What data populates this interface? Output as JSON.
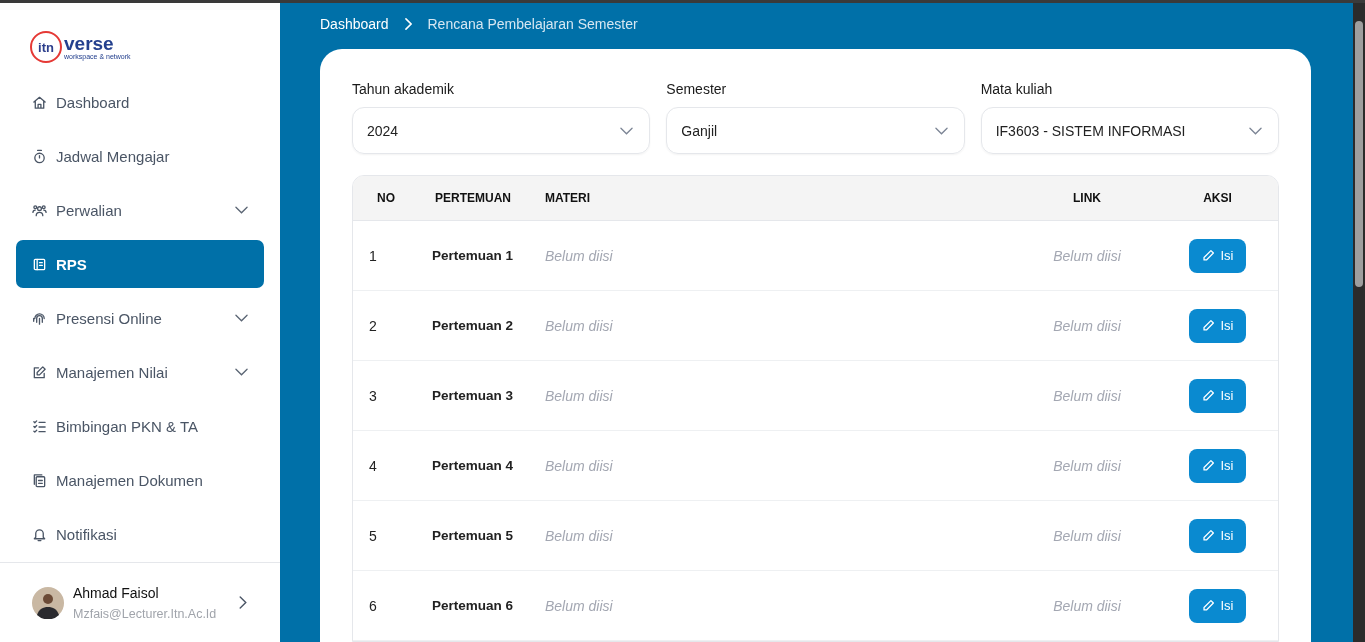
{
  "logo": {
    "mark": "itn",
    "word": "verse",
    "tagline": "workspace & network"
  },
  "sidebar": {
    "items": [
      {
        "label": "Dashboard",
        "selected": false,
        "expandable": false
      },
      {
        "label": "Jadwal Mengajar",
        "selected": false,
        "expandable": false
      },
      {
        "label": "Perwalian",
        "selected": false,
        "expandable": true
      },
      {
        "label": "RPS",
        "selected": true,
        "expandable": false
      },
      {
        "label": "Presensi Online",
        "selected": false,
        "expandable": true
      },
      {
        "label": "Manajemen Nilai",
        "selected": false,
        "expandable": true
      },
      {
        "label": "Bimbingan PKN & TA",
        "selected": false,
        "expandable": false
      },
      {
        "label": "Manajemen Dokumen",
        "selected": false,
        "expandable": false
      },
      {
        "label": "Notifikasi",
        "selected": false,
        "expandable": false
      }
    ],
    "user": {
      "name": "Ahmad Faisol",
      "email": "Mzfais@Lecturer.Itn.Ac.Id"
    }
  },
  "breadcrumb": [
    "Dashboard",
    "Rencana Pembelajaran Semester"
  ],
  "filters": [
    {
      "label": "Tahun akademik",
      "value": "2024"
    },
    {
      "label": "Semester",
      "value": "Ganjil"
    },
    {
      "label": "Mata kuliah",
      "value": "IF3603 - SISTEM INFORMASI"
    }
  ],
  "table": {
    "columns": [
      "NO",
      "PERTEMUAN",
      "MATERI",
      "LINK",
      "AKSI"
    ],
    "rows": [
      {
        "no": "1",
        "pertemuan": "Pertemuan 1",
        "materi": "Belum diisi",
        "link": "Belum diisi",
        "action": "Isi"
      },
      {
        "no": "2",
        "pertemuan": "Pertemuan 2",
        "materi": "Belum diisi",
        "link": "Belum diisi",
        "action": "Isi"
      },
      {
        "no": "3",
        "pertemuan": "Pertemuan 3",
        "materi": "Belum diisi",
        "link": "Belum diisi",
        "action": "Isi"
      },
      {
        "no": "4",
        "pertemuan": "Pertemuan 4",
        "materi": "Belum diisi",
        "link": "Belum diisi",
        "action": "Isi"
      },
      {
        "no": "5",
        "pertemuan": "Pertemuan 5",
        "materi": "Belum diisi",
        "link": "Belum diisi",
        "action": "Isi"
      },
      {
        "no": "6",
        "pertemuan": "Pertemuan 6",
        "materi": "Belum diisi",
        "link": "Belum diisi",
        "action": "Isi"
      }
    ]
  }
}
